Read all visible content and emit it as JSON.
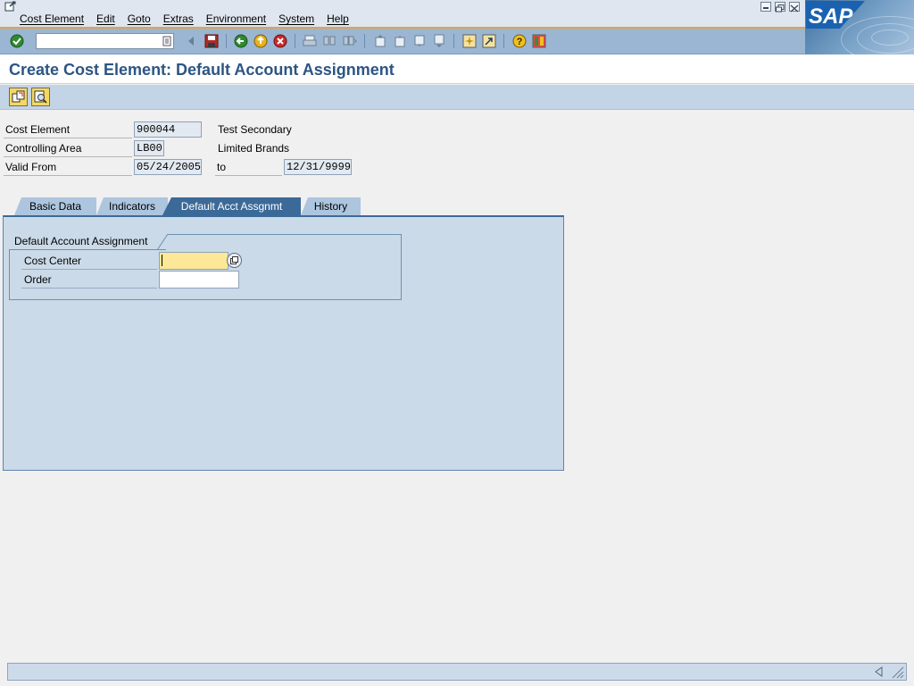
{
  "menu": {
    "items": [
      "Cost Element",
      "Edit",
      "Goto",
      "Extras",
      "Environment",
      "System",
      "Help"
    ]
  },
  "brand": {
    "logo_text": "SAP"
  },
  "toolbar": {
    "command_field_value": "",
    "icons": [
      "enter-icon",
      "command-dropdown-icon",
      "back-nav-icon",
      "save-icon",
      "back-icon",
      "exit-icon",
      "cancel-icon",
      "print-icon",
      "find-icon",
      "find-next-icon",
      "first-page-icon",
      "previous-page-icon",
      "next-page-icon",
      "last-page-icon",
      "create-session-icon",
      "shortcut-icon",
      "help-icon",
      "layout-menu-icon"
    ]
  },
  "title": "Create Cost Element: Default Account Assignment",
  "app_toolbar": {
    "icons": [
      "display-change-icon",
      "more-details-icon"
    ]
  },
  "header": {
    "cost_element_label": "Cost Element",
    "cost_element_value": "900044",
    "cost_element_desc": "Test Secondary",
    "controlling_area_label": "Controlling Area",
    "controlling_area_value": "LB00",
    "controlling_area_desc": "Limited Brands",
    "valid_from_label": "Valid From",
    "valid_from_value": "05/24/2005",
    "to_label": "to",
    "valid_to_value": "12/31/9999"
  },
  "tabs": [
    {
      "label": "Basic Data",
      "active": false
    },
    {
      "label": "Indicators",
      "active": false
    },
    {
      "label": "Default Acct Assgnmt",
      "active": true
    },
    {
      "label": "History",
      "active": false
    }
  ],
  "group": {
    "title": "Default Account Assignment",
    "cost_center_label": "Cost Center",
    "cost_center_value": "",
    "order_label": "Order",
    "order_value": ""
  },
  "colors": {
    "title": "#2d5582",
    "toolbar": "#9ab6d3",
    "active_tab": "#3c6a98",
    "required_field": "#fde898",
    "accent_line": "#e0a24a"
  }
}
